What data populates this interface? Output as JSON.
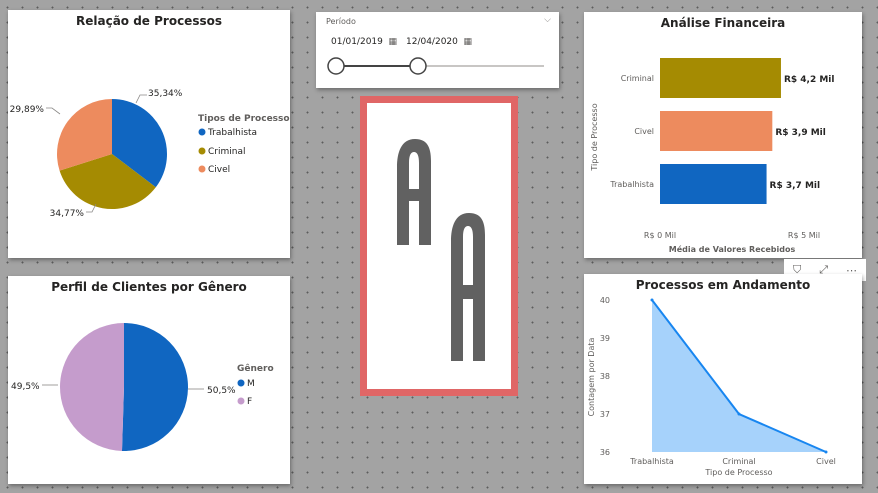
{
  "pie_processos": {
    "title": "Relação de Processos",
    "legend_title": "Tipos de Processo",
    "legend": [
      "Trabalhista",
      "Criminal",
      "Civel"
    ]
  },
  "pie_genero": {
    "title": "Perfil de Clientes por Gênero",
    "legend_title": "Gênero",
    "legend": [
      "M",
      "F"
    ]
  },
  "slicer": {
    "header": "Período",
    "start_date": "01/01/2019",
    "end_date": "12/04/2020"
  },
  "financeira": {
    "title": "Análise Financeira"
  },
  "andamento": {
    "title": "Processos em Andamento"
  },
  "colors": {
    "trabalhista": "#1066c1",
    "criminal": "#a58b02",
    "civel": "#ed8b5e",
    "masculino": "#1066c1",
    "feminino": "#c59ccc",
    "area_fill": "#a6d2fb",
    "area_line": "#1886f0",
    "logo_frame": "#e06666",
    "logo_letter": "#616161"
  },
  "toolbar_icons": [
    "filter-icon",
    "focus-mode-icon",
    "more-options-icon"
  ],
  "chart_data": [
    {
      "type": "pie",
      "title": "Relação de Processos",
      "legend_title": "Tipos de Processo",
      "legend_position": "right",
      "categories": [
        "Trabalhista",
        "Criminal",
        "Civel"
      ],
      "values": [
        35.34,
        34.77,
        29.89
      ],
      "labels": [
        "35,34%",
        "34,77%",
        "29,89%"
      ]
    },
    {
      "type": "pie",
      "title": "Perfil de Clientes por Gênero",
      "legend_title": "Gênero",
      "legend_position": "right",
      "categories": [
        "M",
        "F"
      ],
      "values": [
        50.5,
        49.5
      ],
      "labels": [
        "50,5%",
        "49,5%"
      ]
    },
    {
      "type": "bar",
      "orientation": "horizontal",
      "title": "Análise Financeira",
      "categories": [
        "Criminal",
        "Civel",
        "Trabalhista"
      ],
      "values": [
        4.2,
        3.9,
        3.7
      ],
      "labels": [
        "R$ 4,2 Mil",
        "R$ 3,9 Mil",
        "R$ 3,7 Mil"
      ],
      "xlabel": "Média de Valores Recebidos",
      "ylabel": "Tipo de Processo",
      "xlim": [
        0,
        5
      ],
      "xticks": [
        "R$ 0 Mil",
        "R$ 5 Mil"
      ],
      "grid": false
    },
    {
      "type": "area",
      "title": "Processos em Andamento",
      "categories": [
        "Trabalhista",
        "Criminal",
        "Civel"
      ],
      "values": [
        40,
        37,
        36
      ],
      "xlabel": "Tipo de Processo",
      "ylabel": "Contagem por Data",
      "ylim": [
        36,
        40
      ],
      "yticks": [
        "40",
        "39",
        "38",
        "37",
        "36"
      ],
      "grid": false
    }
  ]
}
